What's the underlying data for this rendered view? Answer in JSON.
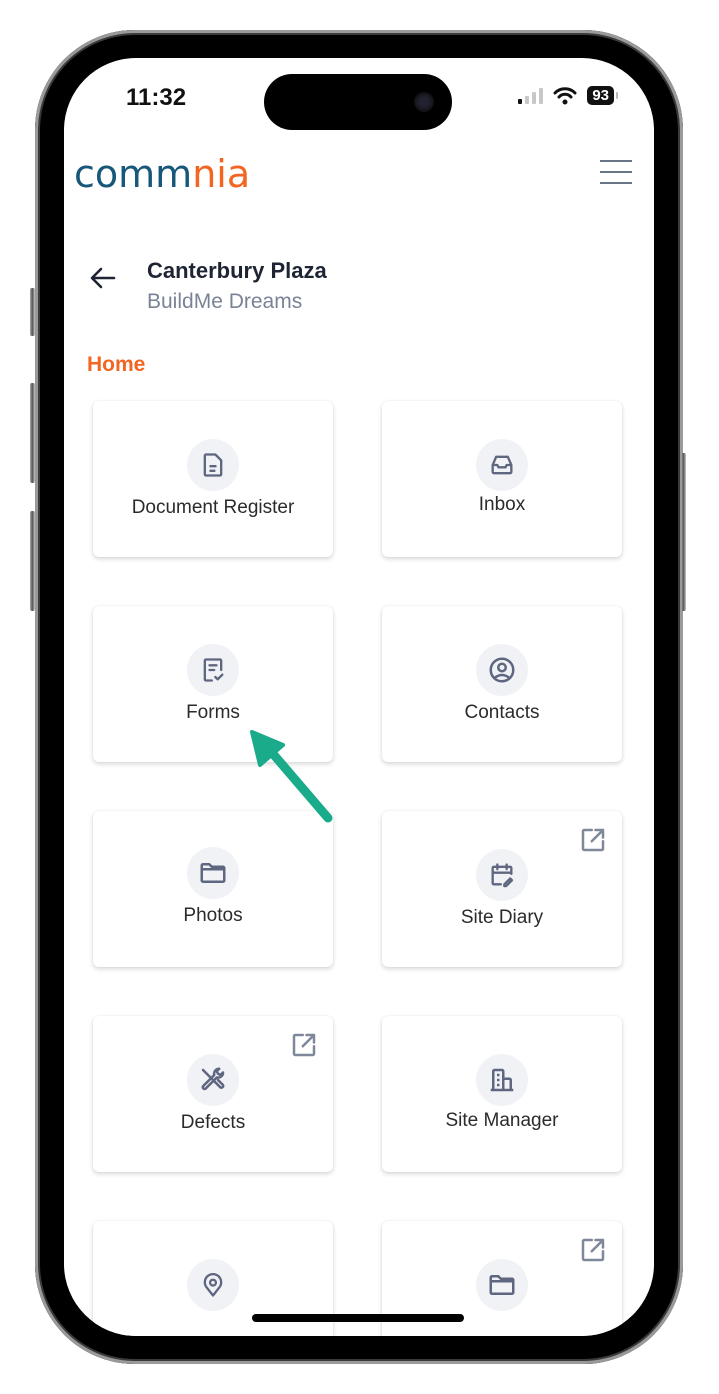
{
  "status_bar": {
    "time": "11:32",
    "battery": "93"
  },
  "app": {
    "logo_left": "comm",
    "logo_right": "nia",
    "brand_blue": "#17577a",
    "brand_orange": "#f26522"
  },
  "project": {
    "title": "Canterbury Plaza",
    "subtitle": "BuildMe Dreams"
  },
  "section": {
    "label": "Home"
  },
  "tiles": [
    {
      "label": "Document Register",
      "icon": "document-icon",
      "external": false
    },
    {
      "label": "Inbox",
      "icon": "inbox-icon",
      "external": false
    },
    {
      "label": "Forms",
      "icon": "form-check-icon",
      "external": false
    },
    {
      "label": "Contacts",
      "icon": "user-circle-icon",
      "external": false
    },
    {
      "label": "Photos",
      "icon": "folder-icon",
      "external": false
    },
    {
      "label": "Site Diary",
      "icon": "calendar-edit-icon",
      "external": true
    },
    {
      "label": "Defects",
      "icon": "tools-icon",
      "external": true
    },
    {
      "label": "Site Manager",
      "icon": "building-icon",
      "external": false
    },
    {
      "label": "",
      "icon": "location-pin-icon",
      "external": false
    },
    {
      "label": "",
      "icon": "folder-icon",
      "external": true
    }
  ],
  "annotation": {
    "target": "Forms",
    "color": "#1aab8a"
  }
}
